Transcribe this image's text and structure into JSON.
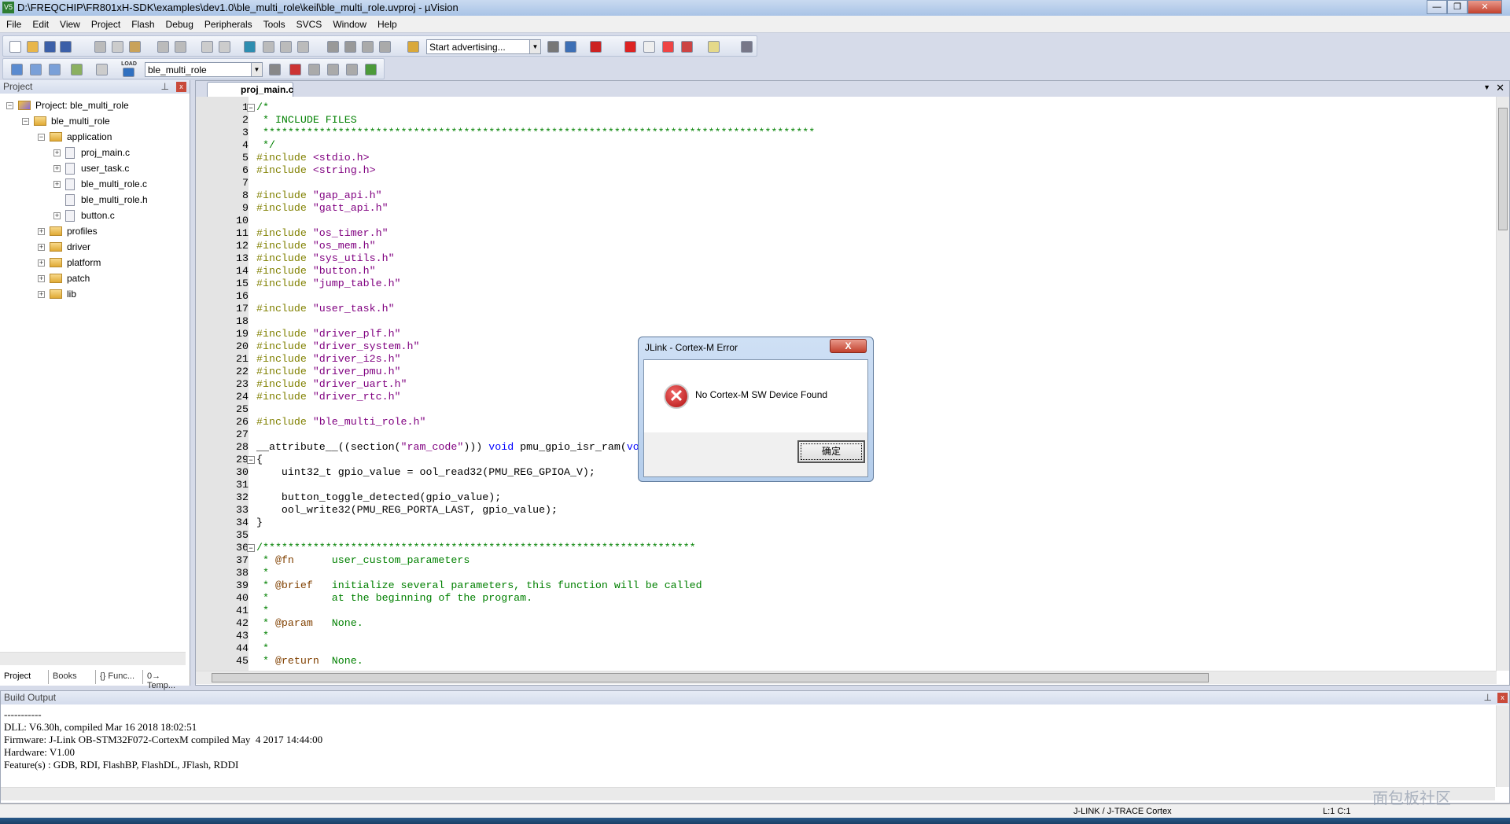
{
  "window": {
    "title": "D:\\FREQCHIP\\FR801xH-SDK\\examples\\dev1.0\\ble_multi_role\\keil\\ble_multi_role.uvproj - µVision",
    "app_icon": "V5"
  },
  "menu": [
    "File",
    "Edit",
    "View",
    "Project",
    "Flash",
    "Debug",
    "Peripherals",
    "Tools",
    "SVCS",
    "Window",
    "Help"
  ],
  "toolbar1": {
    "find_combo": "Start advertising..."
  },
  "toolbar2": {
    "target_combo": "ble_multi_role",
    "load_label": "LOAD"
  },
  "project_panel": {
    "title": "Project",
    "tree": [
      {
        "label": "Project: ble_multi_role",
        "level": 0,
        "type": "project",
        "expander": "-"
      },
      {
        "label": "ble_multi_role",
        "level": 1,
        "type": "target",
        "expander": "-"
      },
      {
        "label": "application",
        "level": 2,
        "type": "folder",
        "expander": "-"
      },
      {
        "label": "proj_main.c",
        "level": 3,
        "type": "file",
        "expander": "+"
      },
      {
        "label": "user_task.c",
        "level": 3,
        "type": "file",
        "expander": "+"
      },
      {
        "label": "ble_multi_role.c",
        "level": 3,
        "type": "file",
        "expander": "+"
      },
      {
        "label": "ble_multi_role.h",
        "level": 3,
        "type": "file",
        "expander": ""
      },
      {
        "label": "button.c",
        "level": 3,
        "type": "file",
        "expander": "+"
      },
      {
        "label": "profiles",
        "level": 2,
        "type": "folder",
        "expander": "+"
      },
      {
        "label": "driver",
        "level": 2,
        "type": "folder",
        "expander": "+"
      },
      {
        "label": "platform",
        "level": 2,
        "type": "folder",
        "expander": "+"
      },
      {
        "label": "patch",
        "level": 2,
        "type": "folder",
        "expander": "+"
      },
      {
        "label": "lib",
        "level": 2,
        "type": "folder",
        "expander": "+"
      }
    ],
    "bottom_tabs": [
      "Project",
      "Books",
      "{} Func...",
      "0→ Temp..."
    ]
  },
  "editor": {
    "tab": "proj_main.c",
    "lines": [
      {
        "n": "1",
        "fold": "-",
        "seg": [
          [
            "cm",
            "/*"
          ]
        ]
      },
      {
        "n": "2",
        "seg": [
          [
            "cm",
            " * INCLUDE FILES"
          ]
        ]
      },
      {
        "n": "3",
        "seg": [
          [
            "cm",
            " ****************************************************************************************"
          ]
        ]
      },
      {
        "n": "4",
        "seg": [
          [
            "cm",
            " */"
          ]
        ]
      },
      {
        "n": "5",
        "seg": [
          [
            "pp",
            "#include "
          ],
          [
            "str",
            "<stdio.h>"
          ]
        ]
      },
      {
        "n": "6",
        "seg": [
          [
            "pp",
            "#include "
          ],
          [
            "str",
            "<string.h>"
          ]
        ]
      },
      {
        "n": "7",
        "seg": []
      },
      {
        "n": "8",
        "seg": [
          [
            "pp",
            "#include "
          ],
          [
            "str",
            "\"gap_api.h\""
          ]
        ]
      },
      {
        "n": "9",
        "seg": [
          [
            "pp",
            "#include "
          ],
          [
            "str",
            "\"gatt_api.h\""
          ]
        ]
      },
      {
        "n": "10",
        "seg": []
      },
      {
        "n": "11",
        "seg": [
          [
            "pp",
            "#include "
          ],
          [
            "str",
            "\"os_timer.h\""
          ]
        ]
      },
      {
        "n": "12",
        "seg": [
          [
            "pp",
            "#include "
          ],
          [
            "str",
            "\"os_mem.h\""
          ]
        ]
      },
      {
        "n": "13",
        "seg": [
          [
            "pp",
            "#include "
          ],
          [
            "str",
            "\"sys_utils.h\""
          ]
        ]
      },
      {
        "n": "14",
        "seg": [
          [
            "pp",
            "#include "
          ],
          [
            "str",
            "\"button.h\""
          ]
        ]
      },
      {
        "n": "15",
        "seg": [
          [
            "pp",
            "#include "
          ],
          [
            "str",
            "\"jump_table.h\""
          ]
        ]
      },
      {
        "n": "16",
        "seg": []
      },
      {
        "n": "17",
        "seg": [
          [
            "pp",
            "#include "
          ],
          [
            "str",
            "\"user_task.h\""
          ]
        ]
      },
      {
        "n": "18",
        "seg": []
      },
      {
        "n": "19",
        "seg": [
          [
            "pp",
            "#include "
          ],
          [
            "str",
            "\"driver_plf.h\""
          ]
        ]
      },
      {
        "n": "20",
        "seg": [
          [
            "pp",
            "#include "
          ],
          [
            "str",
            "\"driver_system.h\""
          ]
        ]
      },
      {
        "n": "21",
        "seg": [
          [
            "pp",
            "#include "
          ],
          [
            "str",
            "\"driver_i2s.h\""
          ]
        ]
      },
      {
        "n": "22",
        "seg": [
          [
            "pp",
            "#include "
          ],
          [
            "str",
            "\"driver_pmu.h\""
          ]
        ]
      },
      {
        "n": "23",
        "seg": [
          [
            "pp",
            "#include "
          ],
          [
            "str",
            "\"driver_uart.h\""
          ]
        ]
      },
      {
        "n": "24",
        "seg": [
          [
            "pp",
            "#include "
          ],
          [
            "str",
            "\"driver_rtc.h\""
          ]
        ]
      },
      {
        "n": "25",
        "seg": []
      },
      {
        "n": "26",
        "seg": [
          [
            "pp",
            "#include "
          ],
          [
            "str",
            "\"ble_multi_role.h\""
          ]
        ]
      },
      {
        "n": "27",
        "seg": []
      },
      {
        "n": "28",
        "seg": [
          [
            "pl",
            "__attribute__((section("
          ],
          [
            "str",
            "\"ram_code\""
          ],
          [
            "pl",
            "))) "
          ],
          [
            "kw",
            "void"
          ],
          [
            "pl",
            " pmu_gpio_isr_ram("
          ],
          [
            "kw",
            "vo"
          ]
        ]
      },
      {
        "n": "29",
        "fold": "-",
        "seg": [
          [
            "pl",
            "{"
          ]
        ]
      },
      {
        "n": "30",
        "seg": [
          [
            "pl",
            "    uint32_t gpio_value = ool_read32(PMU_REG_GPIOA_V);"
          ]
        ]
      },
      {
        "n": "31",
        "seg": []
      },
      {
        "n": "32",
        "seg": [
          [
            "pl",
            "    button_toggle_detected(gpio_value);"
          ]
        ]
      },
      {
        "n": "33",
        "seg": [
          [
            "pl",
            "    ool_write32(PMU_REG_PORTA_LAST, gpio_value);"
          ]
        ]
      },
      {
        "n": "34",
        "seg": [
          [
            "pl",
            "}"
          ]
        ]
      },
      {
        "n": "35",
        "seg": []
      },
      {
        "n": "36",
        "fold": "-",
        "seg": [
          [
            "cm",
            "/*********************************************************************"
          ]
        ]
      },
      {
        "n": "37",
        "seg": [
          [
            "cm",
            " * "
          ],
          [
            "tag",
            "@fn"
          ],
          [
            "cm",
            "      user_custom_parameters"
          ]
        ]
      },
      {
        "n": "38",
        "seg": [
          [
            "cm",
            " *"
          ]
        ]
      },
      {
        "n": "39",
        "seg": [
          [
            "cm",
            " * "
          ],
          [
            "tag",
            "@brief"
          ],
          [
            "cm",
            "   initialize several parameters, this function will be called"
          ]
        ]
      },
      {
        "n": "40",
        "seg": [
          [
            "cm",
            " *          at the beginning of the program."
          ]
        ]
      },
      {
        "n": "41",
        "seg": [
          [
            "cm",
            " *"
          ]
        ]
      },
      {
        "n": "42",
        "seg": [
          [
            "cm",
            " * "
          ],
          [
            "tag",
            "@param"
          ],
          [
            "cm",
            "   None."
          ]
        ]
      },
      {
        "n": "43",
        "seg": [
          [
            "cm",
            " *"
          ]
        ]
      },
      {
        "n": "44",
        "seg": [
          [
            "cm",
            " *"
          ]
        ]
      },
      {
        "n": "45",
        "seg": [
          [
            "cm",
            " * "
          ],
          [
            "tag",
            "@return"
          ],
          [
            "cm",
            "  None."
          ]
        ]
      }
    ]
  },
  "build_output": {
    "title": "Build Output",
    "lines": [
      "-----------",
      "DLL: V6.30h, compiled Mar 16 2018 18:02:51",
      "Firmware: J-Link OB-STM32F072-CortexM compiled May  4 2017 14:44:00",
      "Hardware: V1.00",
      "Feature(s) : GDB, RDI, FlashBP, FlashDL, JFlash, RDDI"
    ]
  },
  "status": {
    "debugger": "J-LINK / J-TRACE Cortex",
    "position": "L:1 C:1",
    "watermark": "面包板社区"
  },
  "dialog": {
    "title": "JLink - Cortex-M Error",
    "message": "No Cortex-M SW Device Found",
    "ok_label": "确定",
    "close_label": "X",
    "icon": "error-icon"
  },
  "colors": {
    "comment": "#008000",
    "preprocessor": "#808000",
    "string": "#800080",
    "keyword": "#0000ff",
    "error": "#c41a1a"
  }
}
